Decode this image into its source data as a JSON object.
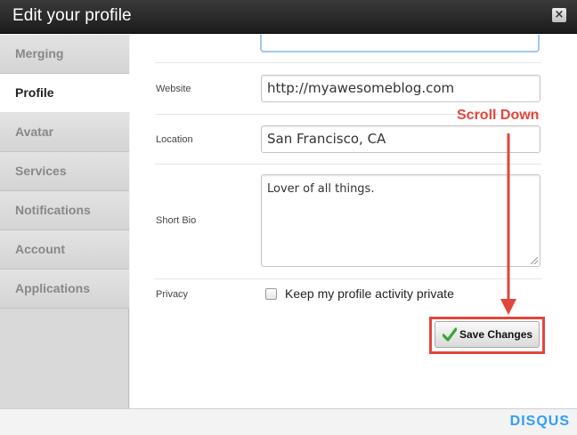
{
  "window": {
    "title": "Edit your profile",
    "close_label": "×"
  },
  "sidebar": {
    "items": [
      {
        "label": "Merging",
        "active": false
      },
      {
        "label": "Profile",
        "active": true
      },
      {
        "label": "Avatar",
        "active": false
      },
      {
        "label": "Services",
        "active": false
      },
      {
        "label": "Notifications",
        "active": false
      },
      {
        "label": "Account",
        "active": false
      },
      {
        "label": "Applications",
        "active": false
      }
    ]
  },
  "form": {
    "website": {
      "label": "Website",
      "value": "http://myawesomeblog.com"
    },
    "location": {
      "label": "Location",
      "value": "San Francisco, CA"
    },
    "bio": {
      "label": "Short Bio",
      "value": "Lover of all things."
    },
    "privacy": {
      "label": "Privacy",
      "checkbox_label": "Keep my profile activity private",
      "checked": false
    }
  },
  "actions": {
    "save_label": "Save Changes"
  },
  "annotation": {
    "text": "Scroll Down",
    "color": "#e2463b"
  },
  "footer": {
    "brand": "DISQUS",
    "brand_color": "#2e9fff"
  }
}
